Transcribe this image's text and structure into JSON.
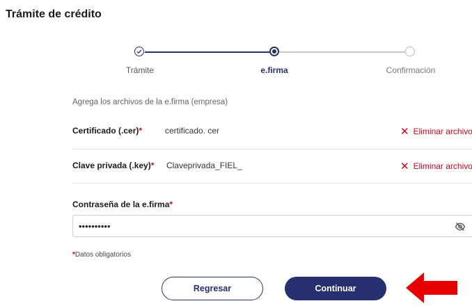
{
  "page": {
    "title": "Trámite de crédito"
  },
  "stepper": {
    "steps": [
      {
        "label": "Trámite",
        "state": "done"
      },
      {
        "label": "e.firma",
        "state": "active"
      },
      {
        "label": "Confirmación",
        "state": "pending"
      }
    ]
  },
  "form": {
    "intro": "Agrega los archivos de la e.firma (empresa)",
    "certificate": {
      "label": "Certificado (.cer)",
      "required_mark": "*",
      "file_name": "certificado. cer",
      "remove_label": "Eliminar archivo"
    },
    "private_key": {
      "label": "Clave privada (.key)",
      "required_mark": "*",
      "file_name": "Claveprivada_FIEL_",
      "remove_label": "Eliminar archivo"
    },
    "password": {
      "label": "Contraseña de la e.firma",
      "required_mark": "*",
      "value": "••••••••••"
    },
    "required_note_mark": "*",
    "required_note": "Datos obligatorios"
  },
  "actions": {
    "back_label": "Regresar",
    "continue_label": "Continuar"
  },
  "colors": {
    "primary": "#27306e",
    "required": "#d0021b",
    "arrow": "#e60000"
  },
  "icons": {
    "done_step": "check-icon",
    "remove": "close-icon",
    "password_toggle": "eye-off-icon",
    "annotation": "arrow-left-icon"
  }
}
